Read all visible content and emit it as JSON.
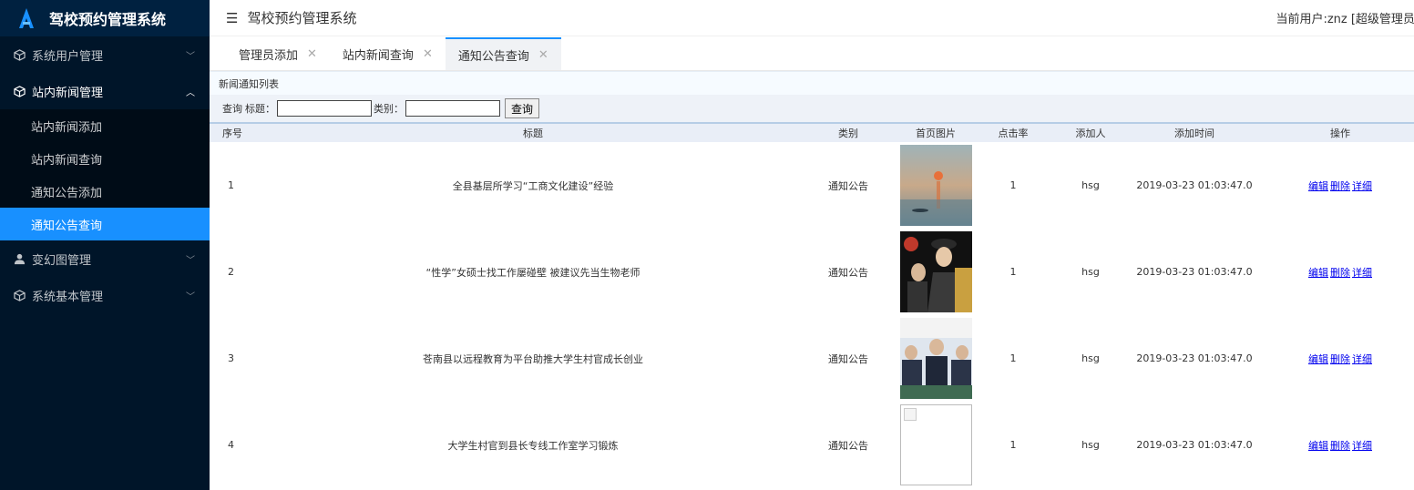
{
  "app": {
    "title": "驾校预约管理系统",
    "current_user": "当前用户:znz [超级管理员]"
  },
  "sidebar": {
    "groups": [
      {
        "label": "系统用户管理",
        "icon": "cube-icon",
        "open": false
      },
      {
        "label": "站内新闻管理",
        "icon": "cube-icon",
        "open": true,
        "items": [
          {
            "label": "站内新闻添加"
          },
          {
            "label": "站内新闻查询"
          },
          {
            "label": "通知公告添加"
          },
          {
            "label": "通知公告查询",
            "active": true
          }
        ]
      },
      {
        "label": "变幻图管理",
        "icon": "user-icon",
        "open": false
      },
      {
        "label": "系统基本管理",
        "icon": "cube-icon",
        "open": false
      }
    ]
  },
  "header": {
    "fold_icon": "menu-fold-icon"
  },
  "tabs": [
    {
      "label": "管理员添加",
      "active": false
    },
    {
      "label": "站内新闻查询",
      "active": false
    },
    {
      "label": "通知公告查询",
      "active": true
    }
  ],
  "list": {
    "title": "新闻通知列表",
    "search": {
      "prefix": "查询",
      "title_label": "标题：",
      "title_value": "",
      "category_label": "类别：",
      "category_value": "",
      "button": "查询"
    },
    "columns": [
      "序号",
      "标题",
      "类别",
      "首页图片",
      "点击率",
      "添加人",
      "添加时间",
      "操作"
    ],
    "rows": [
      {
        "no": "1",
        "title": "全县基层所学习“工商文化建设”经验",
        "category": "通知公告",
        "image": "impressionist-sunrise-painting",
        "clicks": "1",
        "author": "hsg",
        "time": "2019-03-23 01:03:47.0"
      },
      {
        "no": "2",
        "title": "“性学”女硕士找工作屡碰壁 被建议先当生物老师",
        "category": "通知公告",
        "image": "qing-dynasty-costume-drama",
        "clicks": "1",
        "author": "hsg",
        "time": "2019-03-23 01:03:47.0"
      },
      {
        "no": "3",
        "title": "苍南县以远程教育为平台助推大学生村官成长创业",
        "category": "通知公告",
        "image": "meeting-officials-photo",
        "clicks": "1",
        "author": "hsg",
        "time": "2019-03-23 01:03:47.0"
      },
      {
        "no": "4",
        "title": "大学生村官到县长专线工作室学习锻炼",
        "category": "通知公告",
        "image": "broken-image",
        "clicks": "1",
        "author": "hsg",
        "time": "2019-03-23 01:03:47.0"
      }
    ],
    "actions": {
      "edit": "编辑",
      "delete": "删除",
      "detail": "详细"
    }
  },
  "colors": {
    "sidebar_bg": "#001529",
    "accent": "#1890ff",
    "link": "#0000ee"
  }
}
